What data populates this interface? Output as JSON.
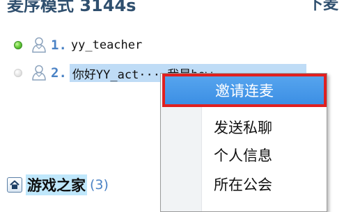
{
  "header": {
    "title": "麦序模式 3144s",
    "right_label": "下麦"
  },
  "mic_queue": [
    {
      "index": "1.",
      "name": "yy_teacher",
      "status": "online"
    },
    {
      "index": "2.",
      "name": "你好YY_act····我是how",
      "status": "offline"
    }
  ],
  "channel": {
    "name": "游戏之家",
    "count": "(3)"
  },
  "context_menu": {
    "items": [
      {
        "label": "邀请连麦"
      },
      {
        "label": "发送私聊"
      },
      {
        "label": "个人信息"
      },
      {
        "label": "所在公会"
      }
    ]
  },
  "colors": {
    "accent": "#4a82c5",
    "selection": "#bfdcf6",
    "menu_highlight": "#4a9ae8",
    "highlight_border": "#e02020",
    "online": "#5cc33a"
  }
}
